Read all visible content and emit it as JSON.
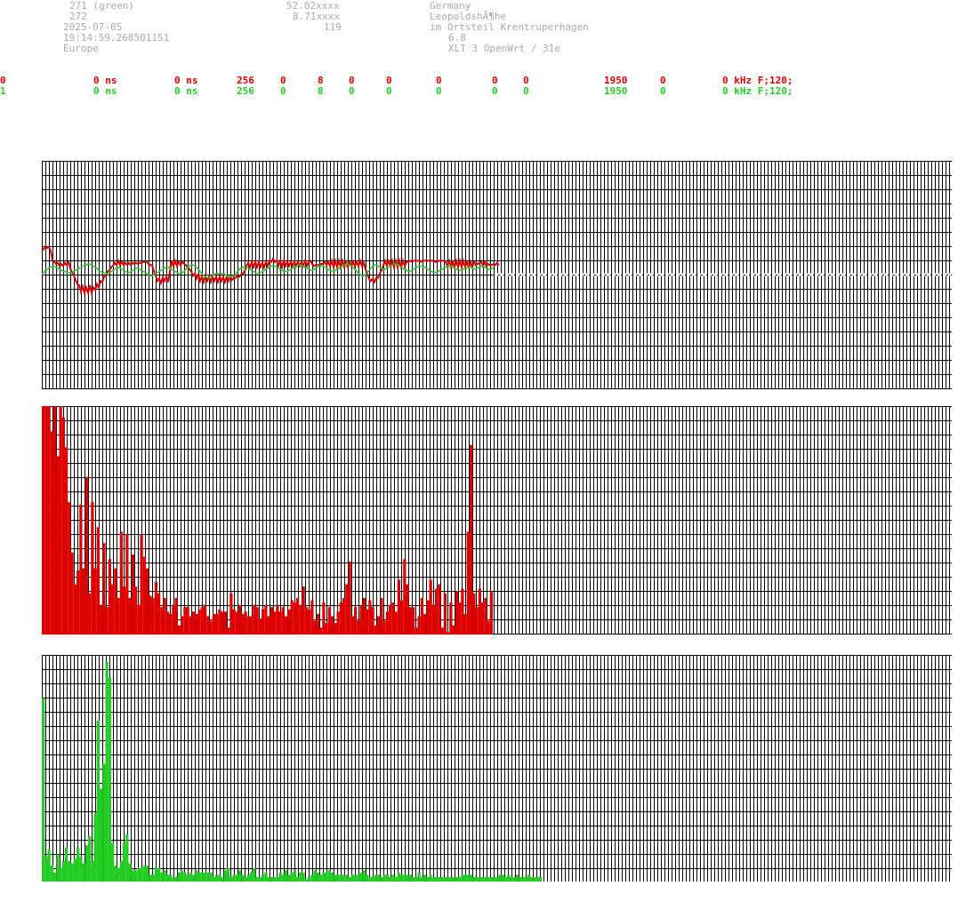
{
  "header": {
    "col1": [
      "271 (green)",
      "272",
      "2025-07-05",
      "19:14:59.268501151",
      "Europe"
    ],
    "col2": [
      "52.02xxxx",
      "8.71xxxx",
      "119"
    ],
    "col3": [
      "Germany",
      "LeopoldshÃ¶he",
      "im Ortsteil Krentruperhagen",
      "6.8",
      "XLT 3 OpenWrt / 31e"
    ]
  },
  "stats_rows": [
    [
      "0",
      "0 ns",
      "0 ns",
      "256",
      "0",
      "8",
      "0",
      "0",
      "0",
      "0",
      "0",
      "1950",
      "0",
      "0 kHz F;120;"
    ],
    [
      "1",
      "0 ns",
      "0 ns",
      "256",
      "0",
      "8",
      "0",
      "0",
      "0",
      "0",
      "0",
      "1950",
      "0",
      "0 kHz F;120;"
    ]
  ],
  "colors": {
    "red": "#dd0000",
    "green": "#22cc22",
    "grid": "#000000",
    "label": "#aaaaaa"
  },
  "chart_data": [
    {
      "type": "line",
      "grid": true,
      "x": [
        0,
        1,
        2,
        3,
        4,
        5,
        6,
        7,
        8,
        9,
        10,
        11,
        12,
        13,
        14,
        15,
        16,
        17,
        18,
        19,
        20,
        21,
        22,
        23,
        24,
        25,
        26,
        27,
        28,
        29,
        30,
        31,
        32,
        33,
        34,
        35,
        36,
        37,
        38,
        39,
        40,
        41,
        42,
        43,
        44,
        45,
        46,
        47,
        48,
        49,
        50,
        51,
        52,
        53,
        54,
        55,
        56,
        57,
        58,
        59,
        60,
        61,
        62,
        63,
        64,
        65,
        66,
        67,
        68,
        69,
        70,
        71,
        72,
        73,
        74,
        75,
        76,
        77,
        78,
        79,
        80,
        81,
        82,
        83,
        84,
        85,
        86,
        87,
        88,
        89,
        90,
        91,
        92,
        93,
        94,
        95,
        96,
        97,
        98,
        99,
        100,
        101,
        102,
        103,
        104,
        105,
        106,
        107,
        108,
        109,
        110,
        111,
        112,
        113,
        114,
        115,
        116,
        117,
        118,
        119,
        120,
        121,
        122,
        123,
        124,
        125,
        126,
        127,
        128,
        129,
        130,
        131,
        132,
        133,
        134,
        135,
        136,
        137,
        138,
        139,
        140,
        141,
        142,
        143,
        144,
        145,
        146,
        147,
        148,
        149,
        150,
        151,
        152,
        153,
        154,
        155,
        156,
        157,
        158,
        159,
        160,
        161,
        162,
        163,
        164,
        165,
        166,
        167,
        168,
        169,
        170,
        171,
        172,
        173,
        174,
        175,
        176,
        177,
        178,
        179,
        180,
        181,
        182,
        183,
        184,
        185,
        186,
        187,
        188,
        189,
        190,
        191,
        192,
        193,
        194,
        195,
        196,
        197,
        198,
        199,
        200,
        201,
        202,
        203,
        204,
        205,
        206,
        207,
        208,
        209,
        210,
        211,
        212,
        213,
        214,
        215,
        216,
        217,
        218,
        219,
        220,
        221,
        222,
        223,
        224,
        225,
        226,
        227,
        228,
        229,
        230,
        231,
        232,
        233,
        234,
        235,
        236,
        237,
        238,
        239,
        240,
        241,
        242,
        243,
        244,
        245,
        246,
        247,
        248,
        249,
        250,
        251,
        252,
        253,
        254,
        255
      ],
      "series": [
        {
          "color": "#dd0000",
          "values": [
            2.2,
            2.4,
            2.6,
            2.5,
            2.6,
            2.2,
            1.4,
            1.2,
            1.0,
            1.1,
            0.8,
            1.0,
            0.8,
            1.1,
            0.9,
            1.2,
            0.6,
            0.2,
            -0.1,
            -0.5,
            -0.9,
            -1.0,
            -1.6,
            -1.1,
            -1.7,
            -1.2,
            -1.7,
            -1.0,
            -1.7,
            -1.2,
            -1.4,
            -0.9,
            -1.2,
            -0.6,
            -0.7,
            -0.2,
            -0.1,
            0.3,
            0.4,
            0.7,
            0.8,
            1.1,
            0.9,
            1.3,
            0.9,
            1.2,
            0.9,
            1.1,
            0.9,
            1.1,
            0.9,
            1.1,
            1.0,
            1.1,
            1.0,
            1.1,
            1.1,
            1.2,
            1.2,
            1.2,
            1.0,
            0.9,
            0.9,
            0.3,
            -0.1,
            -0.6,
            -0.4,
            -0.8,
            -0.3,
            -0.6,
            -0.2,
            -0.7,
            0.3,
            1.3,
            0.8,
            1.3,
            0.8,
            1.2,
            0.9,
            1.2,
            1.0,
            0.9,
            0.7,
            0.5,
            0.3,
            -0.1,
            0.1,
            -0.4,
            0.0,
            -0.6,
            -0.2,
            -0.7,
            -0.1,
            -0.6,
            -0.2,
            -0.7,
            -0.2,
            -0.6,
            -0.2,
            -0.7,
            -0.2,
            -0.6,
            -0.2,
            -0.7,
            -0.2,
            -0.6,
            -0.2,
            -0.5,
            -0.3,
            -0.3,
            -0.1,
            -0.2,
            0.0,
            0.1,
            0.3,
            0.8,
            1.1,
            0.7,
            1.2,
            0.7,
            1.2,
            0.7,
            1.2,
            0.7,
            1.1,
            0.7,
            1.2,
            0.8,
            1.3,
            1.2,
            1.5,
            1.2,
            1.3,
            0.8,
            1.3,
            0.7,
            1.3,
            0.8,
            1.2,
            0.8,
            1.2,
            0.8,
            1.2,
            0.8,
            1.2,
            0.8,
            1.2,
            0.8,
            1.3,
            0.8,
            1.2,
            1.3,
            1.0,
            0.8,
            0.9,
            0.9,
            0.9,
            1.0,
            1.0,
            1.2,
            0.9,
            1.2,
            0.8,
            1.3,
            0.7,
            1.3,
            0.7,
            1.3,
            0.7,
            1.3,
            0.7,
            1.2,
            0.7,
            1.2,
            0.8,
            1.2,
            0.8,
            1.2,
            0.8,
            1.3,
            0.8,
            1.1,
            0.5,
            0.0,
            -0.4,
            -0.6,
            -0.4,
            -0.7,
            -0.3,
            -0.3,
            0.1,
            0.4,
            0.9,
            1.3,
            0.8,
            1.4,
            0.7,
            1.3,
            0.7,
            1.3,
            0.7,
            1.3,
            0.7,
            1.3,
            0.8,
            1.2,
            1.2,
            1.3,
            1.2,
            1.3,
            1.3,
            1.3,
            1.3,
            1.2,
            1.3,
            1.3,
            1.3,
            1.3,
            1.3,
            1.3,
            1.3,
            1.2,
            1.2,
            1.3,
            1.3,
            1.3,
            1.3,
            1.2,
            0.8,
            1.3,
            0.7,
            1.2,
            0.7,
            1.3,
            0.7,
            1.3,
            0.7,
            1.3,
            0.7,
            1.3,
            0.6,
            1.2,
            0.7,
            1.2,
            0.9,
            1.0,
            1.1,
            1.2,
            0.8,
            1.2,
            0.8,
            1.0,
            0.9,
            0.9,
            1.0,
            0.9,
            1.1,
            0.9
          ]
        },
        {
          "color": "#22cc22",
          "values": [
            0.0,
            0.2,
            0.4,
            0.5,
            0.6,
            0.7,
            0.8,
            0.8,
            0.7,
            0.6,
            0.5,
            0.4,
            0.3,
            0.3,
            0.2,
            0.2,
            0.2,
            0.2,
            0.3,
            0.4,
            0.5,
            0.6,
            0.7,
            0.8,
            0.9,
            0.9,
            1.0,
            1.0,
            0.9,
            0.8,
            0.7,
            0.6,
            0.4,
            0.3,
            0.2,
            0.2,
            0.1,
            0.1,
            0.2,
            0.3,
            0.4,
            0.5,
            0.6,
            0.7,
            0.6,
            0.5,
            0.4,
            0.3,
            0.2,
            0.2,
            0.3,
            0.4,
            0.5,
            0.6,
            0.6,
            0.5,
            0.4,
            0.3,
            0.2,
            0.1,
            0.0,
            -0.1,
            -0.1,
            0.0,
            0.1,
            0.2,
            0.3,
            0.4,
            0.5,
            0.6,
            0.7,
            0.7,
            0.6,
            0.5,
            0.4,
            0.3,
            0.2,
            0.1,
            0.1,
            0.2,
            0.3,
            0.5,
            0.7,
            0.8,
            0.9,
            0.9,
            0.8,
            0.7,
            0.5,
            0.3,
            0.1,
            -0.1,
            -0.2,
            -0.3,
            -0.3,
            -0.2,
            -0.1,
            0.0,
            0.1,
            0.1,
            0.1,
            0.1,
            0.1,
            0.0,
            -0.1,
            -0.2,
            -0.2,
            -0.2,
            -0.1,
            0.1,
            0.3,
            0.5,
            0.6,
            0.7,
            0.7,
            0.7,
            0.6,
            0.5,
            0.4,
            0.3,
            0.2,
            0.1,
            0.1,
            0.2,
            0.3,
            0.4,
            0.5,
            0.6,
            0.7,
            0.8,
            0.8,
            0.8,
            0.7,
            0.6,
            0.5,
            0.4,
            0.3,
            0.3,
            0.3,
            0.4,
            0.5,
            0.6,
            0.7,
            0.8,
            0.9,
            0.9,
            0.9,
            0.8,
            0.7,
            0.6,
            0.5,
            0.4,
            0.4,
            0.5,
            0.6,
            0.7,
            0.8,
            0.8,
            0.8,
            0.7,
            0.6,
            0.5,
            0.4,
            0.3,
            0.3,
            0.4,
            0.5,
            0.6,
            0.7,
            0.8,
            0.9,
            1.0,
            1.0,
            0.9,
            0.8,
            0.7,
            0.5,
            0.3,
            0.1,
            0.0,
            -0.1,
            -0.1,
            0.0,
            0.2,
            0.4,
            0.6,
            0.8,
            0.9,
            0.9,
            0.8,
            0.7,
            0.6,
            0.5,
            0.5,
            0.6,
            0.7,
            0.8,
            0.9,
            1.0,
            1.0,
            0.9,
            0.8,
            0.7,
            0.6,
            0.5,
            0.4,
            0.3,
            0.3,
            0.4,
            0.5,
            0.6,
            0.7,
            0.8,
            0.8,
            0.8,
            0.7,
            0.6,
            0.5,
            0.4,
            0.3,
            0.2,
            0.2,
            0.2,
            0.3,
            0.4,
            0.5,
            0.6,
            0.7,
            0.8,
            0.8,
            0.8,
            0.7,
            0.6,
            0.5,
            0.4,
            0.4,
            0.4,
            0.5,
            0.6,
            0.6,
            0.7,
            0.7,
            0.6,
            0.5,
            0.5,
            0.6,
            0.7,
            0.8,
            0.8,
            0.7,
            0.6,
            0.5,
            0.5,
            0.6,
            0.6
          ]
        }
      ]
    },
    {
      "type": "bar",
      "grid": true,
      "series": [
        {
          "color": "#dd0000",
          "values": [
            100,
            100,
            100,
            89,
            100,
            78,
            100,
            95,
            82,
            58,
            36,
            22,
            28,
            57,
            29,
            69,
            18,
            58,
            29,
            47,
            13,
            40,
            12,
            33,
            22,
            29,
            16,
            45,
            21,
            44,
            16,
            35,
            21,
            13,
            44,
            34,
            29,
            17,
            16,
            23,
            18,
            12,
            16,
            10,
            9,
            13,
            16,
            4,
            8,
            12,
            12,
            8,
            10,
            9,
            11,
            12,
            13,
            8,
            6,
            9,
            9,
            11,
            10,
            10,
            3,
            18,
            11,
            10,
            13,
            9,
            10,
            8,
            8,
            13,
            12,
            7,
            11,
            13,
            8,
            12,
            10,
            13,
            10,
            12,
            8,
            11,
            15,
            14,
            16,
            13,
            21,
            12,
            11,
            15,
            6,
            9,
            3,
            14,
            5,
            12,
            8,
            5,
            10,
            14,
            16,
            22,
            32,
            8,
            12,
            6,
            13,
            16,
            11,
            15,
            12,
            4,
            8,
            16,
            6,
            10,
            13,
            14,
            10,
            24,
            15,
            33,
            22,
            12,
            12,
            3,
            8,
            16,
            9,
            15,
            24,
            13,
            20,
            22,
            3,
            18,
            1,
            14,
            4,
            19,
            14,
            20,
            9,
            45,
            83,
            18,
            12,
            20,
            14,
            16,
            6,
            19
          ]
        }
      ]
    },
    {
      "type": "bar",
      "grid": true,
      "series": [
        {
          "color": "#22cc22",
          "values": [
            81,
            11,
            14,
            7,
            4,
            12,
            6,
            9,
            15,
            9,
            8,
            10,
            15,
            11,
            8,
            16,
            20,
            9,
            30,
            71,
            41,
            52,
            97,
            90,
            17,
            7,
            6,
            9,
            17,
            21,
            8,
            5,
            5,
            6,
            6,
            7,
            7,
            3,
            3,
            6,
            6,
            4,
            5,
            3,
            3,
            2,
            2,
            4,
            5,
            4,
            3,
            4,
            3,
            5,
            4,
            4,
            4,
            4,
            4,
            2,
            3,
            3,
            2,
            5,
            6,
            2,
            3,
            3,
            5,
            3,
            2,
            3,
            4,
            6,
            2,
            2,
            3,
            4,
            2,
            2,
            2,
            2,
            4,
            3,
            5,
            3,
            4,
            5,
            2,
            4,
            4,
            1,
            2,
            3,
            5,
            4,
            3,
            4,
            4,
            5,
            4,
            3,
            3,
            3,
            3,
            3,
            2,
            3,
            3,
            3,
            4,
            5,
            3,
            2,
            2,
            3,
            3,
            2,
            3,
            3,
            2,
            3,
            2,
            4,
            3,
            3,
            3,
            3,
            2,
            2,
            4,
            2,
            3,
            2,
            3,
            2,
            2,
            2,
            2,
            2,
            2,
            2,
            2,
            2,
            2,
            3,
            3,
            3,
            3,
            2,
            2,
            2,
            2,
            2,
            2,
            2,
            2,
            2,
            3,
            3,
            2,
            3,
            2,
            2,
            3,
            2,
            2,
            2,
            3,
            2,
            2,
            2,
            2
          ]
        }
      ]
    }
  ]
}
